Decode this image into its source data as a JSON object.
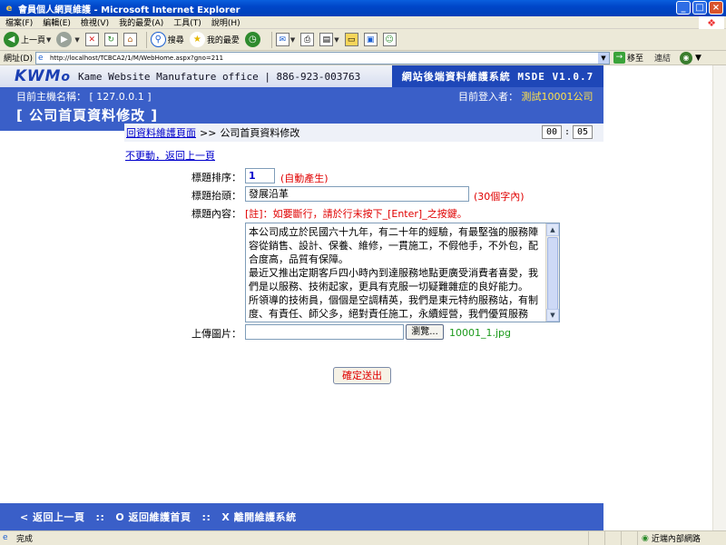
{
  "window": {
    "title": "會員個人網頁維護 - Microsoft Internet Explorer",
    "controls": [
      "_",
      "□",
      "×"
    ]
  },
  "menu": [
    "檔案(F)",
    "編輯(E)",
    "檢視(V)",
    "我的最愛(A)",
    "工具(T)",
    "說明(H)"
  ],
  "toolbar": {
    "back": "上一頁",
    "search": "搜尋",
    "favorites": "我的最愛"
  },
  "address": {
    "label": "網址(D)",
    "url": "http://localhost/TCBCA2/1/M/WebHome.aspx?gno=211",
    "go": "移至",
    "links": "連結"
  },
  "banner": {
    "logo_main": "KWM",
    "logo_suffix": "o",
    "company": "Kame Website Manufature office | 886-923-003763",
    "system": "網站後端資料維護系統 MSDE V1.0.7",
    "host_label": "目前主機名稱：",
    "host_value": "[ 127.0.0.1 ]",
    "user_label": "目前登入者：",
    "user_value": "測試10001公司",
    "page_title": "[ 公司首頁資料修改 ]"
  },
  "breadcrumb": {
    "link": "回資料維護頁面",
    "sep": ">>",
    "current": "公司首頁資料修改",
    "timer_min": "00",
    "timer_colon": ":",
    "timer_sec": "05"
  },
  "form": {
    "back_link": "不更動，返回上一頁",
    "order_label": "標題排序：",
    "order_value": "1",
    "order_hint": "(自動產生)",
    "title_label": "標題抬頭：",
    "title_value": "發展沿革",
    "title_hint": "(30個字內)",
    "content_label": "標題內容：",
    "content_note": "[註]：如要斷行，請於行末按下_[Enter]_之按鍵。",
    "content_value": "本公司成立於民國六十九年，有二十年的經驗，有最堅強的服務陣容從銷售、設計、保養、維修，一貫施工，不假他手，不外包，配合度高，品質有保障。\n最近又推出定期客戶四小時內到達服務地點更廣受消費者喜愛，我們是以服務、技術起家，更具有克服一切疑難雜症的良好能力。\n所領導的技術員，個個是空調精英，我們是東元特約服務站，有制度、有責任、師父多，絕對責任施工，永續經營，我們優質服務",
    "upload_label": "上傳圖片：",
    "browse": "瀏覽...",
    "current_file": "10001_1.jpg",
    "submit": "確定送出"
  },
  "footer": {
    "back": "< 返回上一頁",
    "sep1": "::",
    "home": "O 返回維護首頁",
    "sep2": "::",
    "exit": "X 離開維護系統"
  },
  "status": {
    "text": "完成",
    "zone": "近端內部網路"
  }
}
